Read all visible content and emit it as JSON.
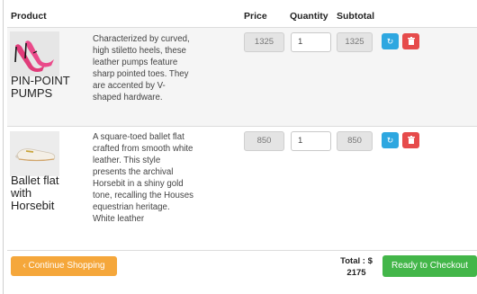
{
  "table": {
    "headers": {
      "product": "Product",
      "price": "Price",
      "quantity": "Quantity",
      "subtotal": "Subtotal"
    },
    "items": [
      {
        "name": "PIN-POINT PUMPS",
        "description": "Characterized by curved, high stiletto heels, these leather pumps feature sharp pointed toes. They are accented by V-shaped hardware.",
        "price": "1325",
        "quantity": "1",
        "subtotal": "1325",
        "image_icon": "pink-stiletto-pumps-image"
      },
      {
        "name": "Ballet flat with Horsebit",
        "description": "A square-toed ballet flat crafted from smooth white leather. This style presents the archival Horsebit in a shiny gold tone, recalling the Houses equestrian heritage. White leather",
        "price": "850",
        "quantity": "1",
        "subtotal": "850",
        "image_icon": "white-ballet-flat-image"
      }
    ]
  },
  "actions": {
    "refresh_icon": "refresh-icon",
    "delete_icon": "trash-icon"
  },
  "footer": {
    "continue_label": "‹ Continue Shopping",
    "total_label": "Total : $",
    "total_value": "2175",
    "checkout_label": "Ready to Checkout"
  },
  "colors": {
    "continue": "#f5a73b",
    "checkout": "#43b649",
    "refresh": "#2ea7e0",
    "delete": "#e64b4b"
  }
}
